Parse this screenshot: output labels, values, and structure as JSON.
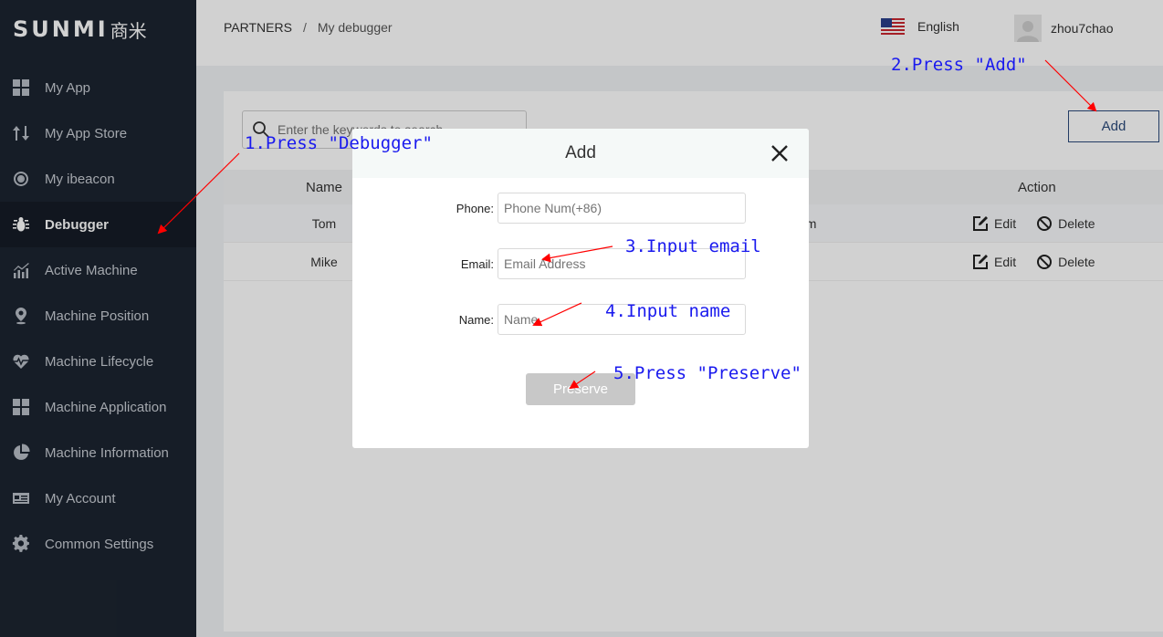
{
  "sidebar": {
    "logo_brand": "SUNMI",
    "logo_cn": "商米",
    "items": [
      {
        "label": "My App",
        "icon": "grid-icon"
      },
      {
        "label": "My App Store",
        "icon": "arrows-updown-icon"
      },
      {
        "label": "My ibeacon",
        "icon": "broadcast-icon"
      },
      {
        "label": "Debugger",
        "icon": "bug-icon",
        "active": true
      },
      {
        "label": "Active Machine",
        "icon": "chart-icon"
      },
      {
        "label": "Machine Position",
        "icon": "location-pin-icon"
      },
      {
        "label": "Machine Lifecycle",
        "icon": "heartbeat-icon"
      },
      {
        "label": "Machine Application",
        "icon": "apps-grid-icon"
      },
      {
        "label": "Machine Information",
        "icon": "pie-chart-icon"
      },
      {
        "label": "My Account",
        "icon": "id-card-icon"
      },
      {
        "label": "Common Settings",
        "icon": "gear-icon"
      }
    ]
  },
  "header": {
    "breadcrumb_root": "PARTNERS",
    "breadcrumb_sep": "/",
    "breadcrumb_current": "My debugger",
    "language": "English",
    "username": "zhou7chao"
  },
  "content": {
    "search_placeholder": "Enter the keywords to search",
    "add_label": "Add",
    "columns": {
      "name": "Name",
      "action": "Action"
    },
    "rows": [
      {
        "name": "Tom",
        "email_tail": "om"
      },
      {
        "name": "Mike",
        "email_tail": "n"
      }
    ],
    "edit_label": "Edit",
    "delete_label": "Delete"
  },
  "modal": {
    "title": "Add",
    "phone_label": "Phone:",
    "phone_placeholder": "Phone Num(+86)",
    "email_label": "Email:",
    "email_placeholder": "Email Address",
    "name_label": "Name:",
    "name_placeholder": "Name",
    "preserve_label": "Preserve"
  },
  "annotations": {
    "step1": "1.Press \"Debugger\"",
    "step2": "2.Press \"Add\"",
    "step3": "3.Input email",
    "step4": "4.Input name",
    "step5": "5.Press \"Preserve\""
  },
  "colors": {
    "sidebar_bg": "#1c2430",
    "accent": "#2b4a7b",
    "annotation": "#1a1aee",
    "arrow": "#ff0000"
  }
}
